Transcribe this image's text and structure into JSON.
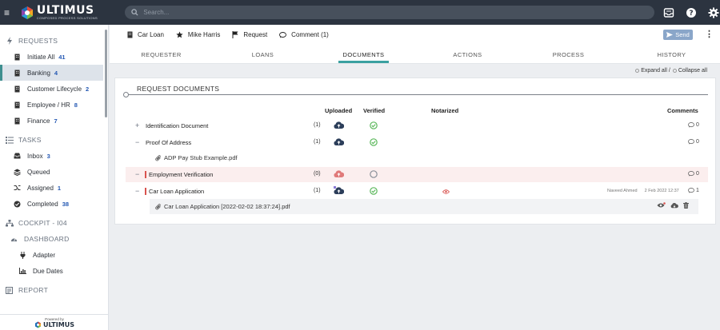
{
  "app": {
    "logo_title": "ULTIMUS",
    "logo_subtitle": "COMPOSED PROCESS SOLUTIONS",
    "search_placeholder": "Search..."
  },
  "sidebar": {
    "requests_label": "REQUESTS",
    "request_items": [
      {
        "label": "Initiate All",
        "count": "41"
      },
      {
        "label": "Banking",
        "count": "4"
      },
      {
        "label": "Customer Lifecycle",
        "count": "2"
      },
      {
        "label": "Employee / HR",
        "count": "8"
      },
      {
        "label": "Finance",
        "count": "7"
      }
    ],
    "tasks_label": "TASKS",
    "task_items": [
      {
        "label": "Inbox",
        "count": "3"
      },
      {
        "label": "Queued",
        "count": ""
      },
      {
        "label": "Assigned",
        "count": "1"
      },
      {
        "label": "Completed",
        "count": "38"
      }
    ],
    "cockpit_label": "COCKPIT - I04",
    "dashboard_label": "DASHBOARD",
    "dashboard_items": [
      {
        "label": "Adapter"
      },
      {
        "label": "Due Dates"
      }
    ],
    "report_label": "REPORT",
    "powered_by": "Powered by",
    "powered_logo": "ULTIMUS"
  },
  "case": {
    "type": "Car Loan",
    "person": "Mike Harris",
    "stage": "Request",
    "comment": "Comment (1)",
    "send_label": "Send"
  },
  "tabs": [
    {
      "label": "REQUESTER"
    },
    {
      "label": "LOANS"
    },
    {
      "label": "DOCUMENTS"
    },
    {
      "label": "ACTIONS"
    },
    {
      "label": "PROCESS"
    },
    {
      "label": "HISTORY"
    }
  ],
  "expand": {
    "expand_all": "Expand all /",
    "collapse_all": "Collapse all"
  },
  "documents": {
    "title": "REQUEST DOCUMENTS",
    "columns": {
      "uploaded": "Uploaded",
      "verified": "Verified",
      "notarized": "Notarized",
      "comments": "Comments"
    },
    "rows": [
      {
        "name": "Identification Document",
        "count": "(1)",
        "comments": "0"
      },
      {
        "name": "Proof Of Address",
        "count": "(1)",
        "comments": "0"
      },
      {
        "file": "ADP Pay Stub Example.pdf"
      },
      {
        "name": "Employment Verification",
        "count": "(0)",
        "comments": "0"
      },
      {
        "name": "Car Loan Application",
        "count": "(1)",
        "comments": "1",
        "author": "Naveed Ahmed",
        "date": "2 Feb 2022 12:37"
      },
      {
        "file": "Car Loan Application [2022-02-02 18:37:24].pdf"
      }
    ]
  },
  "colors": {
    "topbar": "#2c3440",
    "accent": "#3aa0a0",
    "link_count": "#2458b3",
    "uploaded_ok": "#2c3e5a",
    "uploaded_missing": "#e07a7a",
    "verified": "#5cb85c"
  }
}
